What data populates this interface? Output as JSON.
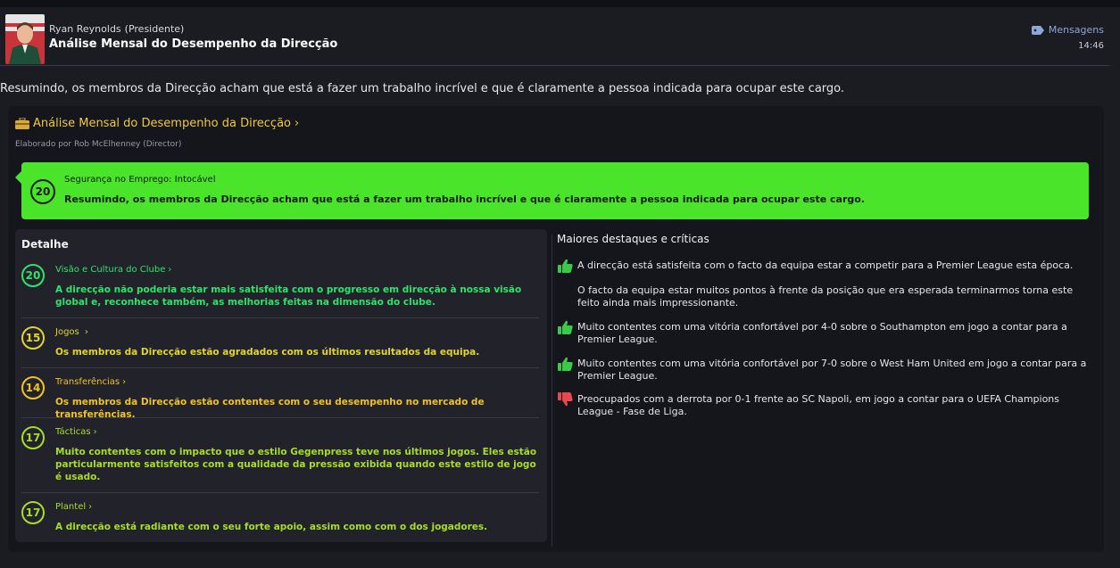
{
  "header": {
    "sender_name": "Ryan Reynolds",
    "sender_role": "(Presidente)",
    "subject": "Análise Mensal do Desempenho da Direcção",
    "messages_link": "Mensagens",
    "time": "14:46"
  },
  "summary": "Resumindo, os membros da Direcção acham que está a fazer um trabalho incrível e que é claramente a pessoa indicada para ocupar este cargo.",
  "panel": {
    "title": "Análise Mensal do Desempenho da Direcção",
    "subtitle": "Elaborado por Rob McElhenney (Director)"
  },
  "security": {
    "score": "20",
    "label": "Segurança no Emprego: Intocável",
    "text": "Resumindo, os membros da Direcção acham que está a fazer um trabalho incrível e que é claramente a pessoa indicada para ocupar este cargo."
  },
  "detail": {
    "title": "Detalhe",
    "items": [
      {
        "score": "20",
        "name": "Visão e Cultura do Clube",
        "text": "A direcção não poderia estar mais satisfeita com o progresso em direcção à nossa visão global e, reconhece também, as melhorias feitas na dimensão do clube."
      },
      {
        "score": "15",
        "name": "Jogos",
        "text": "Os membros da Direcção estão agradados com os últimos resultados da equipa."
      },
      {
        "score": "14",
        "name": "Transferências",
        "text": "Os membros da Direcção estão contentes com o seu desempenho no mercado de transferências."
      },
      {
        "score": "17",
        "name": "Tácticas",
        "text": "Muito contentes com o impacto que o estilo Gegenpress teve nos últimos jogos. Eles estão particularmente satisfeitos com a qualidade da pressão exibida quando este estilo de jogo é usado."
      },
      {
        "score": "17",
        "name": "Plantel",
        "text": "A direcção está radiante com o seu forte apoio, assim como com o dos jogadores."
      }
    ]
  },
  "highlights": {
    "title": "Maiores destaques e críticas",
    "items": [
      {
        "icon": "thumbs-up-icon",
        "text": "A direcção está satisfeita com o facto da equipa estar a competir para a Premier League esta época."
      },
      {
        "icon": "none",
        "text": "O facto da equipa estar muitos pontos à frente da posição que era esperada terminarmos torna este feito ainda mais impressionante."
      },
      {
        "icon": "thumbs-up-icon",
        "text": "Muito contentes com uma vitória confortável por 4-0 sobre o Southampton em jogo a contar para a Premier League."
      },
      {
        "icon": "thumbs-up-icon",
        "text": "Muito contentes com uma vitória confortável por 7-0 sobre o West Ham United em jogo a contar para a Premier League."
      },
      {
        "icon": "thumbs-down-icon",
        "text": "Preocupados com a derrota por 0-1 frente ao SC Napoli, em jogo a contar para o UEFA Champions League - Fase de Liga."
      }
    ]
  },
  "colors": {
    "security_green": "#4ae52a",
    "title_gold": "#f0c93a",
    "score_green": "#2fe36a",
    "score_yellow": "#e2d52a",
    "score_orange": "#f1c224",
    "score_lime": "#a8dc2a",
    "thumbs_up": "#3bc94a",
    "thumbs_down": "#e5484d"
  }
}
